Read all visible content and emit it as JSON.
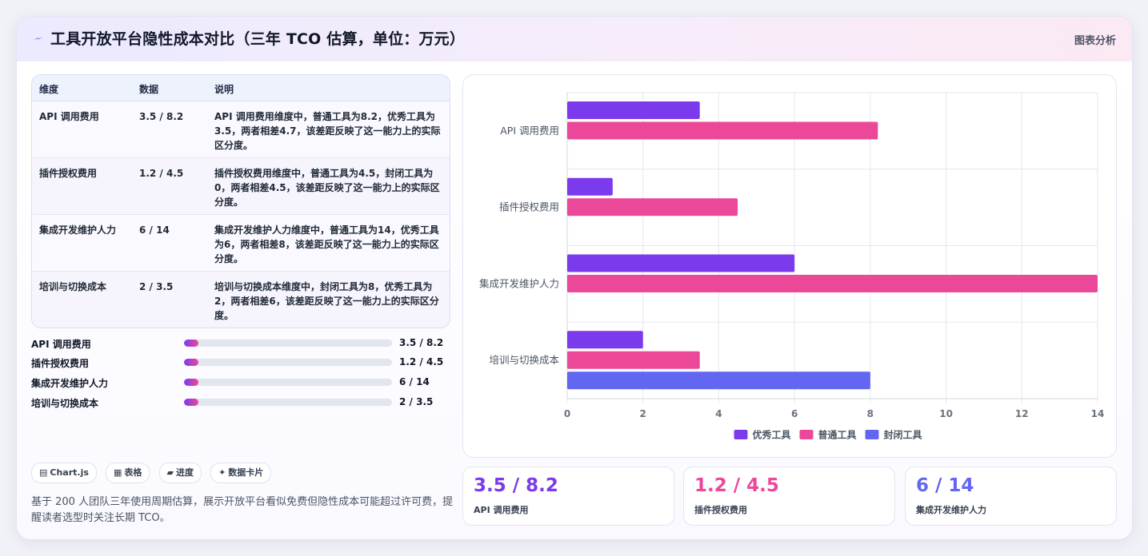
{
  "header": {
    "title": "工具开放平台隐性成本对比（三年 TCO 估算，单位：万元）",
    "view_label": "图表分析",
    "icon": "lightning-icon"
  },
  "table": {
    "headers": [
      "维度",
      "数据",
      "说明"
    ],
    "rows": [
      {
        "dimension": "API 调用费用",
        "data": "3.5 / 8.2",
        "note": "API 调用费用维度中，普通工具为8.2，优秀工具为3.5，两者相差4.7，该差距反映了这一能力上的实际区分度。"
      },
      {
        "dimension": "插件授权费用",
        "data": "1.2 / 4.5",
        "note": "插件授权费用维度中，普通工具为4.5，封闭工具为0，两者相差4.5，该差距反映了这一能力上的实际区分度。"
      },
      {
        "dimension": "集成开发维护人力",
        "data": "6 / 14",
        "note": "集成开发维护人力维度中，普通工具为14，优秀工具为6，两者相差8，该差距反映了这一能力上的实际区分度。"
      },
      {
        "dimension": "培训与切换成本",
        "data": "2 / 3.5",
        "note": "培训与切换成本维度中，封闭工具为8，优秀工具为2，两者相差6，该差距反映了这一能力上的实际区分度。"
      }
    ]
  },
  "progress": [
    {
      "label": "API 调用费用",
      "value": "3.5 / 8.2",
      "fill_pct": 7
    },
    {
      "label": "插件授权费用",
      "value": "1.2 / 4.5",
      "fill_pct": 7
    },
    {
      "label": "集成开发维护人力",
      "value": "6 / 14",
      "fill_pct": 7
    },
    {
      "label": "培训与切换成本",
      "value": "2 / 3.5",
      "fill_pct": 7
    }
  ],
  "chips": [
    {
      "icon": "chart-icon",
      "glyph": "▤",
      "label": "Chart.js"
    },
    {
      "icon": "table-icon",
      "glyph": "▦",
      "label": "表格"
    },
    {
      "icon": "progress-icon",
      "glyph": "▰",
      "label": "进度"
    },
    {
      "icon": "card-icon",
      "glyph": "✦",
      "label": "数据卡片"
    }
  ],
  "description": "基于 200 人团队三年使用周期估算，展示开放平台看似免费但隐性成本可能超过许可费，提醒读者选型时关注长期 TCO。",
  "cards": [
    {
      "value": "3.5 / 8.2",
      "label": "API 调用费用",
      "color": "#7c3aed"
    },
    {
      "value": "1.2 / 4.5",
      "label": "插件授权费用",
      "color": "#ec4899"
    },
    {
      "value": "6 / 14",
      "label": "集成开发维护人力",
      "color": "#6366f1"
    }
  ],
  "chart_data": {
    "type": "bar",
    "orientation": "horizontal",
    "categories": [
      "API 调用费用",
      "插件授权费用",
      "集成开发维护人力",
      "培训与切换成本"
    ],
    "series": [
      {
        "name": "优秀工具",
        "color": "#7c3aed",
        "values": [
          3.5,
          1.2,
          6,
          2
        ]
      },
      {
        "name": "普通工具",
        "color": "#ec4899",
        "values": [
          8.2,
          4.5,
          14,
          3.5
        ]
      },
      {
        "name": "封闭工具",
        "color": "#6366f1",
        "values": [
          null,
          null,
          null,
          8
        ]
      }
    ],
    "xlim": [
      0,
      14
    ],
    "xticks": [
      0,
      2,
      4,
      6,
      8,
      10,
      12,
      14
    ],
    "grid": true,
    "legend": "bottom"
  }
}
